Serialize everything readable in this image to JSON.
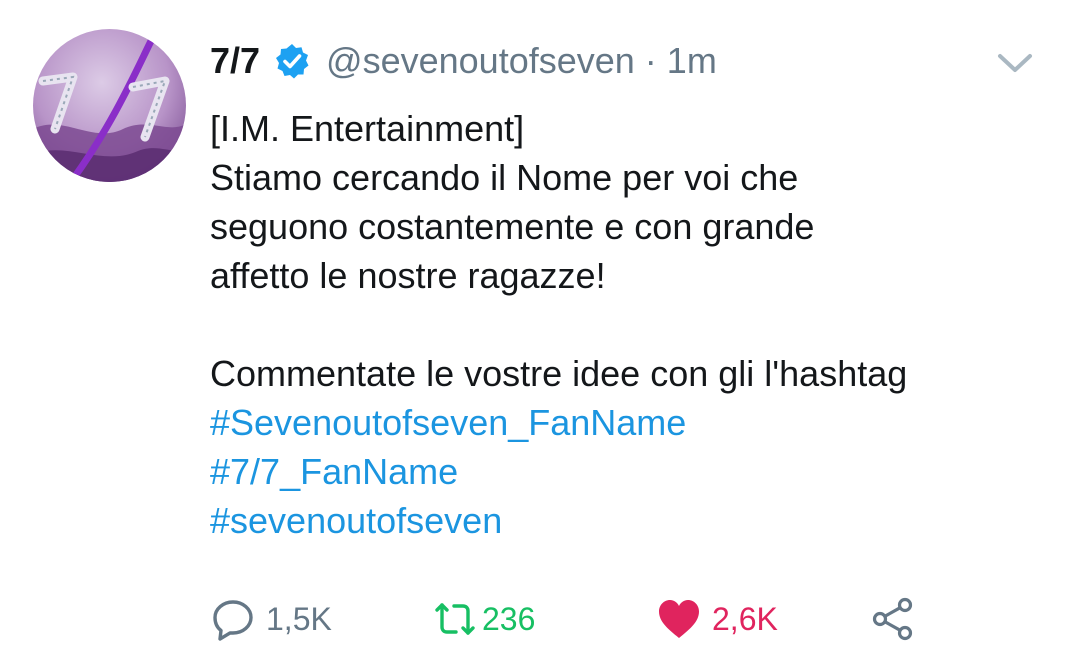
{
  "tweet": {
    "display_name": "7/7",
    "handle": "@sevenoutofseven",
    "separator": "·",
    "time": "1m",
    "body_lines": [
      "[I.M. Entertainment]",
      "Stiamo cercando il Nome per voi che",
      "seguono costantemente e con grande",
      "affetto le nostre ragazze!",
      "Commentate le vostre idee con gli l'hashtag"
    ],
    "hashtags": [
      "#Sevenoutofseven_FanName",
      "#7/7_FanName",
      "#sevenoutofseven"
    ],
    "actions": {
      "reply_count": "1,5K",
      "retweet_count": "236",
      "like_count": "2,6K"
    }
  },
  "icons": {
    "verified": "verified-badge-icon",
    "menu": "chevron-down-icon",
    "reply": "reply-icon",
    "retweet": "retweet-icon",
    "like": "heart-icon",
    "share": "share-icon"
  },
  "colors": {
    "link": "#1b95e0",
    "secondary_text": "#657786",
    "retweet_active": "#17bf63",
    "like_active": "#e0245e",
    "verified": "#1da1f2"
  }
}
